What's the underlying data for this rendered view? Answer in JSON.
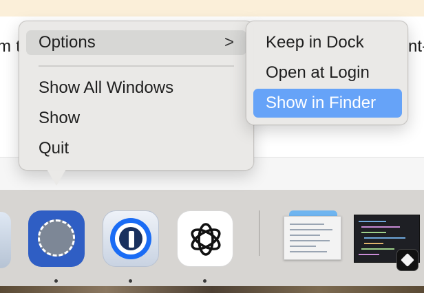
{
  "background": {
    "partial_text_left": "m t",
    "partial_text_right": "nt-"
  },
  "context_menu": {
    "options_label": "Options",
    "options_chevron": ">",
    "items": [
      {
        "label": "Show All Windows"
      },
      {
        "label": "Show"
      },
      {
        "label": "Quit"
      }
    ]
  },
  "options_submenu": {
    "items": [
      {
        "label": "Keep in Dock"
      },
      {
        "label": "Open at Login"
      },
      {
        "label": "Show in Finder",
        "highlighted": true
      }
    ],
    "highlight_color": "#66a3f8"
  },
  "dock": {
    "apps": [
      {
        "icon": "partial-app-icon"
      },
      {
        "icon": "signal-app-icon",
        "running": true
      },
      {
        "icon": "1password-app-icon",
        "running": true
      },
      {
        "icon": "chatgpt-app-icon",
        "running": true
      }
    ],
    "recent": [
      {
        "icon": "finder-folder-thumbnail"
      },
      {
        "icon": "editor-window-thumbnail"
      }
    ]
  }
}
